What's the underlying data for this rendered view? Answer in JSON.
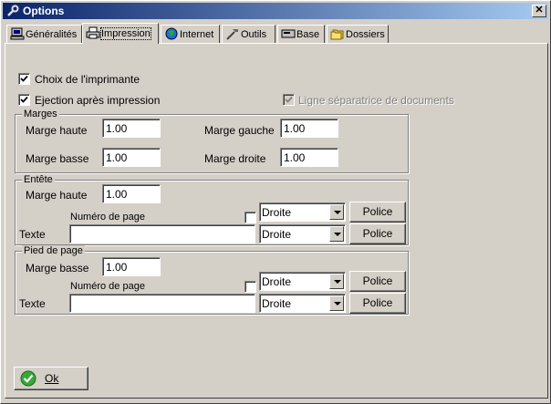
{
  "window": {
    "title": "Options",
    "close_symbol": "✕"
  },
  "tabs": [
    {
      "label": "Généralités",
      "icon": "computer-icon"
    },
    {
      "label": "Impression",
      "icon": "printer-icon",
      "active": true
    },
    {
      "label": "Internet",
      "icon": "globe-icon"
    },
    {
      "label": "Outils",
      "icon": "tools-icon"
    },
    {
      "label": "Base",
      "icon": "database-icon"
    },
    {
      "label": "Dossiers",
      "icon": "folders-icon"
    }
  ],
  "options": {
    "choix_imprimante": {
      "label": "Choix de l'imprimante",
      "checked": true
    },
    "ejection": {
      "label": "Ejection après impression",
      "checked": true
    },
    "ligne_separatrice": {
      "label": "Ligne séparatrice de documents",
      "checked": true,
      "disabled": true
    }
  },
  "marges": {
    "legend": "Marges",
    "haute_label": "Marge haute",
    "haute_value": "1.00",
    "basse_label": "Marge basse",
    "basse_value": "1.00",
    "gauche_label": "Marge gauche",
    "gauche_value": "1.00",
    "droite_label": "Marge droite",
    "droite_value": "1.00"
  },
  "entete": {
    "legend": "Entête",
    "marge_label": "Marge haute",
    "marge_value": "1.00",
    "numero_label": "Numéro de page",
    "numero_checked": false,
    "numero_align": "Droite",
    "texte_label": "Texte",
    "texte_value": "",
    "texte_align": "Droite",
    "police_label_1": "Police",
    "police_label_2": "Police"
  },
  "pied": {
    "legend": "Pied de page",
    "marge_label": "Marge basse",
    "marge_value": "1.00",
    "numero_label": "Numéro de page",
    "numero_checked": false,
    "numero_align": "Droite",
    "texte_label": "Texte",
    "texte_value": "",
    "texte_align": "Droite",
    "police_label_1": "Police",
    "police_label_2": "Police"
  },
  "footer": {
    "ok_label": "Ok",
    "ok_icon": "checkmark-icon"
  },
  "colors": {
    "title_start": "#0a246a",
    "title_end": "#a6caf0",
    "face": "#d4d0c8"
  }
}
